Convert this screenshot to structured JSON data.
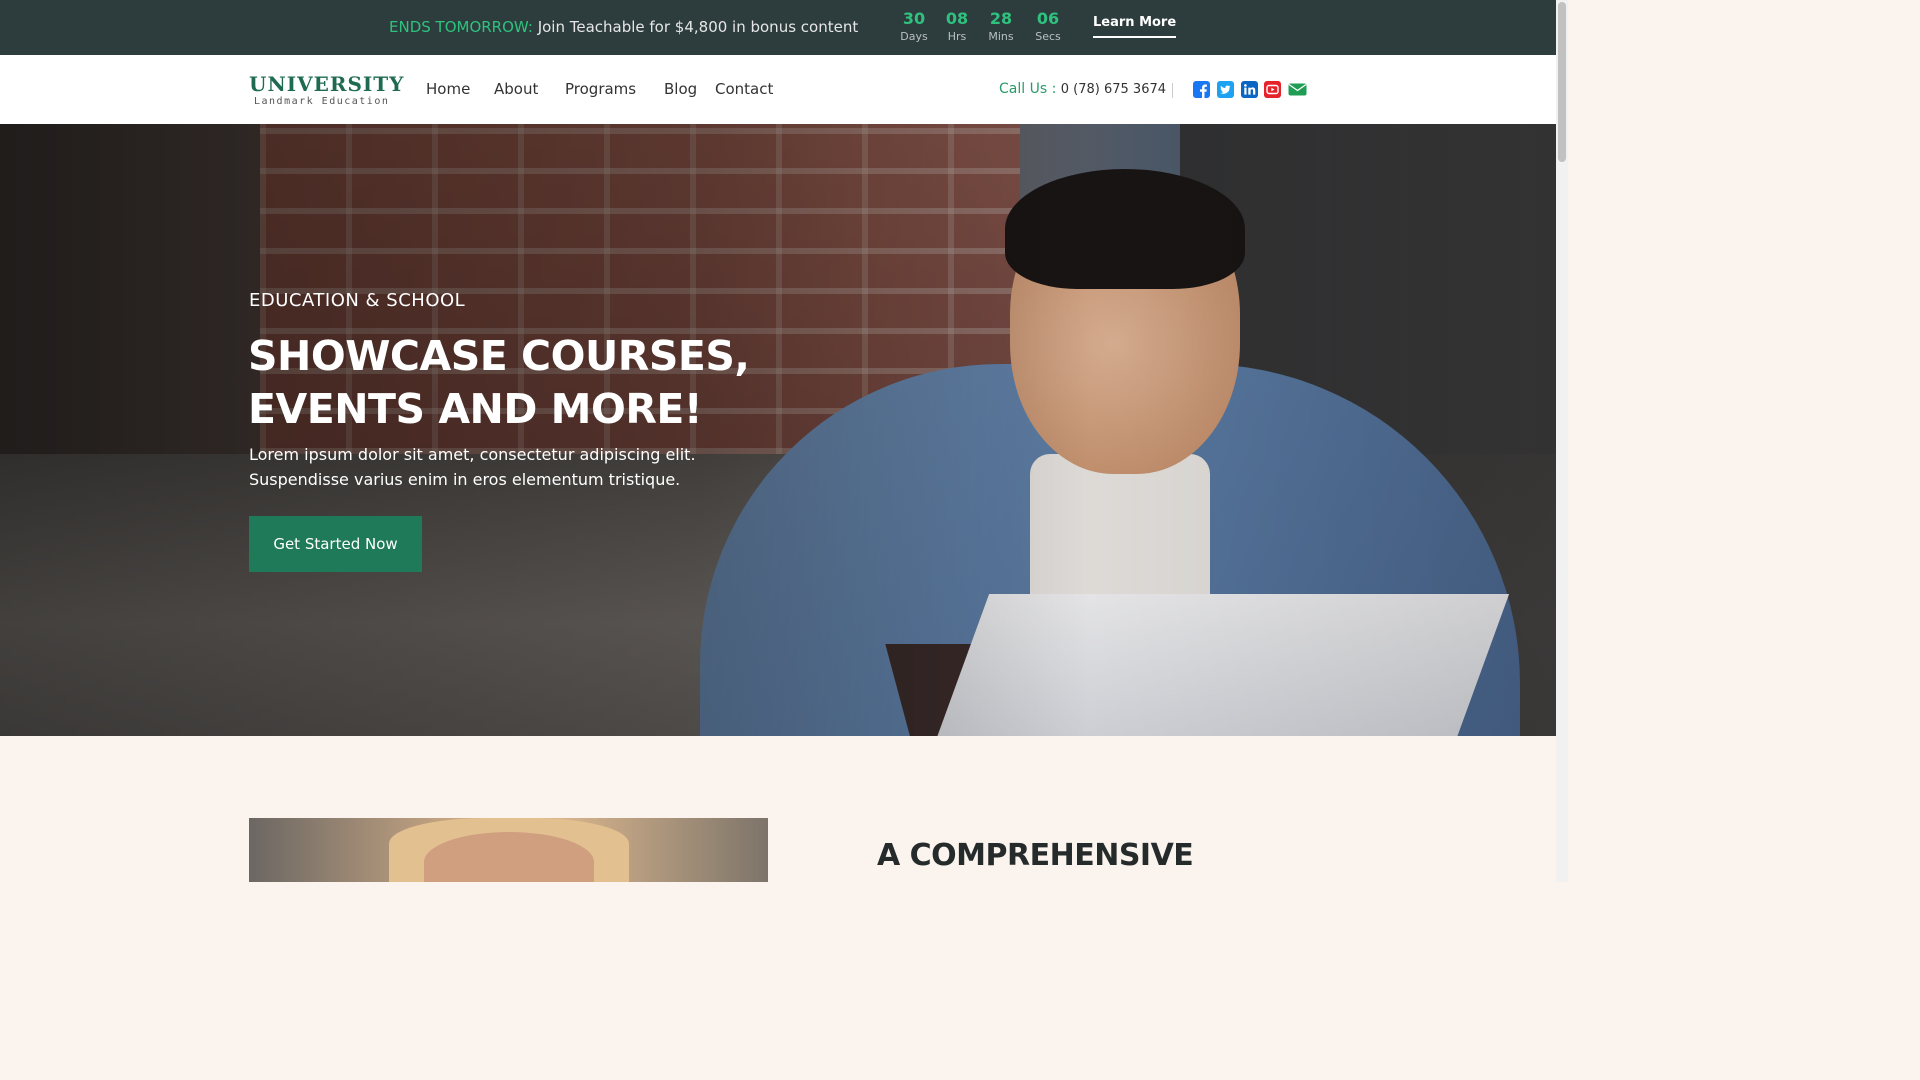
{
  "topbar": {
    "promo_accent": "ENDS TOMORROW:",
    "promo_text": " Join Teachable for $4,800 in bonus content",
    "countdown": [
      {
        "value": "30",
        "unit": "Days"
      },
      {
        "value": "08",
        "unit": "Hrs"
      },
      {
        "value": "28",
        "unit": "Mins"
      },
      {
        "value": "06",
        "unit": "Secs"
      }
    ],
    "learn_more": "Learn More"
  },
  "header": {
    "brand": "UNIVERSITY",
    "tagline": "Landmark Education",
    "nav": [
      "Home",
      "About",
      "Programs",
      "Blog",
      "Contact"
    ],
    "call_label": "Call Us : ",
    "phone": "0 (78) 675 3674",
    "social": [
      "facebook-icon",
      "twitter-icon",
      "linkedin-icon",
      "youtube-icon",
      "email-icon"
    ]
  },
  "hero": {
    "eyebrow": "EDUCATION & SCHOOL",
    "headline_line1": "SHOWCASE COURSES,",
    "headline_line2": "EVENTS AND MORE!",
    "lede_line1": "Lorem ipsum dolor sit amet, consectetur adipiscing elit.",
    "lede_line2": "Suspendisse varius enim in eros elementum tristique.",
    "cta": "Get Started Now"
  },
  "section": {
    "title": "A COMPREHENSIVE"
  },
  "colors": {
    "accent_green": "#2ec27e",
    "brand_green": "#1f6b52",
    "button_green": "#1e7a59",
    "topbar_bg": "#2d3d3e",
    "section_bg": "#fbf3ee",
    "facebook": "#1877f2",
    "twitter": "#1da1f2",
    "linkedin": "#0a66c2",
    "youtube": "#e5232b",
    "email": "#1f9d55"
  }
}
